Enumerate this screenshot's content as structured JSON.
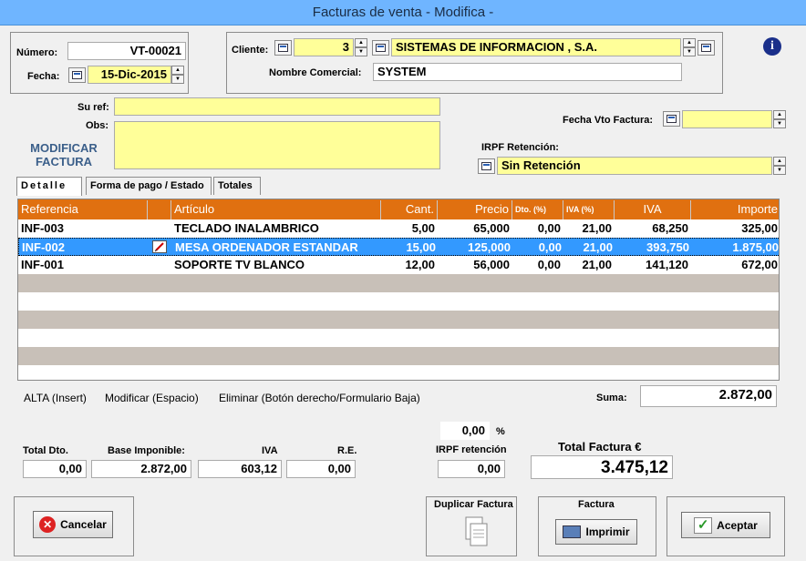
{
  "window": {
    "title": "Facturas de venta - Modifica -"
  },
  "header": {
    "numero_label": "Número:",
    "numero_value": "VT-00021",
    "fecha_label": "Fecha:",
    "fecha_value": "15-Dic-2015",
    "cliente_label": "Cliente:",
    "cliente_code": "3",
    "cliente_name": "SISTEMAS DE INFORMACION , S.A.",
    "nombre_comercial_label": "Nombre Comercial:",
    "nombre_comercial_value": "SYSTEM"
  },
  "form": {
    "su_ref_label": "Su ref:",
    "su_ref_value": "",
    "obs_label": "Obs:",
    "obs_value": "",
    "mode_line1": "MODIFICAR",
    "mode_line2": "FACTURA",
    "fecha_vto_label": "Fecha Vto Factura:",
    "fecha_vto_value": "",
    "irpf_label": "IRPF  Retención:",
    "irpf_value": "Sin Retención"
  },
  "tabs": [
    "Detalle",
    "Forma de pago / Estado",
    "Totales"
  ],
  "grid": {
    "columns": [
      "Referencia",
      "Artículo",
      "Cant.",
      "Precio",
      "Dto. (%)",
      "IVA (%)",
      "IVA",
      "Importe"
    ],
    "rows": [
      {
        "ref": "INF-003",
        "articulo": "TECLADO INALAMBRICO",
        "cant": "5,00",
        "precio": "65,000",
        "dto": "0,00",
        "iva_pct": "21,00",
        "iva": "68,250",
        "importe": "325,00"
      },
      {
        "ref": "INF-002",
        "articulo": "MESA ORDENADOR ESTANDAR",
        "cant": "15,00",
        "precio": "125,000",
        "dto": "0,00",
        "iva_pct": "21,00",
        "iva": "393,750",
        "importe": "1.875,00"
      },
      {
        "ref": "INF-001",
        "articulo": "SOPORTE TV BLANCO",
        "cant": "12,00",
        "precio": "56,000",
        "dto": "0,00",
        "iva_pct": "21,00",
        "iva": "141,120",
        "importe": "672,00"
      }
    ],
    "selected_row": 1
  },
  "grid_footer": {
    "alta": "ALTA (Insert)",
    "modificar": "Modificar (Espacio)",
    "eliminar": "Eliminar (Botón derecho/Formulario Baja)",
    "suma_label": "Suma:",
    "suma_value": "2.872,00"
  },
  "totals": {
    "irpf_pct_value": "0,00",
    "irpf_pct_symbol": "%",
    "total_dto_label": "Total Dto.",
    "total_dto_value": "0,00",
    "base_label": "Base Imponible:",
    "base_value": "2.872,00",
    "iva_label": "IVA",
    "iva_value": "603,12",
    "re_label": "R.E.",
    "re_value": "0,00",
    "irpf_ret_label": "IRPF  retención",
    "irpf_ret_value": "0,00",
    "total_label": "Total Factura  €",
    "total_value": "3.475,12"
  },
  "buttons": {
    "cancelar": "Cancelar",
    "duplicar": "Duplicar Factura",
    "factura_label": "Factura",
    "imprimir": "Imprimir",
    "aceptar": "Aceptar"
  },
  "colors": {
    "grid_header": "#e07010",
    "selected_row": "#3399ff",
    "highlight_field": "#ffff99",
    "mode_text": "#3b5f8a"
  }
}
